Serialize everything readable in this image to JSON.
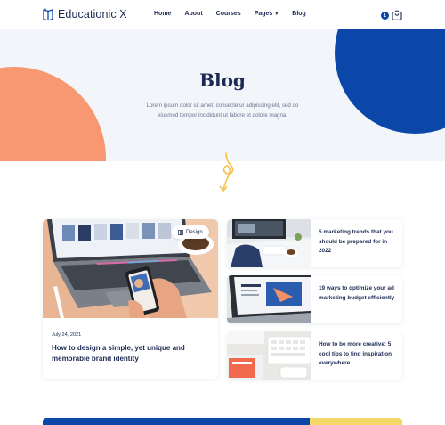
{
  "brand": {
    "name": "Educationic X",
    "icon": "book-icon"
  },
  "nav": {
    "items": [
      {
        "label": "Home"
      },
      {
        "label": "About"
      },
      {
        "label": "Courses"
      },
      {
        "label": "Pages",
        "has_dropdown": true
      },
      {
        "label": "Blog"
      }
    ]
  },
  "cart": {
    "count": "1",
    "icon": "shopping-bag-icon"
  },
  "hero": {
    "title": "Blog",
    "description_line1": "Lorem ipsum dolor sit amet, consectetur adipiscing elit, sed do",
    "description_line2": "eiusmod tempor incididunt ut labore et dolore magna."
  },
  "featured_post": {
    "tag": "Design",
    "tag_icon": "category-icon",
    "date": "July 24, 2021",
    "title": "How to design a simple, yet unique and memorable brand identity"
  },
  "side_posts": [
    {
      "title": "5 marketing trends that you should be prepared for in 2022"
    },
    {
      "title": "19 ways to optimize your ad marketing budget efficiently"
    },
    {
      "title": "How to be more creative: 5 cool tips to find inspiration everywhere"
    }
  ],
  "colors": {
    "primary_blue": "#0b47a8",
    "accent_orange": "#f79872",
    "accent_yellow": "#f6d76a",
    "text_dark": "#1b2a52",
    "hero_bg": "#f2f5f9"
  }
}
